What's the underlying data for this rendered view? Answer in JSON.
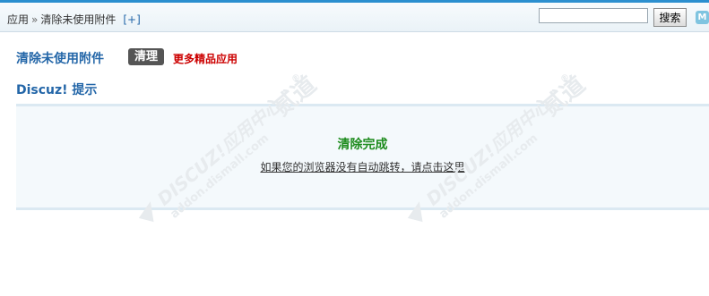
{
  "nav": {
    "breadcrumb_root": "应用",
    "breadcrumb_sep": "»",
    "breadcrumb_current": "清除未使用附件",
    "add_shortcut": "[+]"
  },
  "search": {
    "value": "",
    "placeholder": "",
    "button_label": "搜索"
  },
  "corner_icon_letter": "M",
  "section": {
    "title": "清除未使用附件",
    "clean_button": "清理",
    "more_apps_link": "更多精品应用"
  },
  "tip": {
    "title": "Discuz! 提示",
    "message_title": "清除完成",
    "message_link": "如果您的浏览器没有自动跳转，请点击这里"
  },
  "watermark": {
    "brand": "DISCUZ!应用中心",
    "site": "addon.dismall.com",
    "mark": "贰道",
    "registered": "®"
  },
  "colors": {
    "link_blue": "#2366a8",
    "accent_red": "#cc0000",
    "success_green": "#1e8c1e",
    "top_bar": "#2b8fcf"
  }
}
